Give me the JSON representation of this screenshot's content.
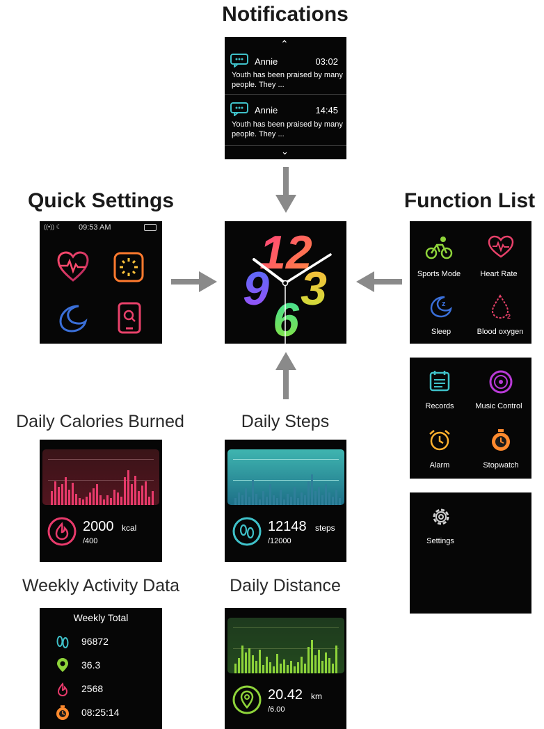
{
  "headings": {
    "notifications": "Notifications",
    "quick_settings": "Quick Settings",
    "function_list": "Function List"
  },
  "captions": {
    "calories": "Daily Calories Burned",
    "steps": "Daily Steps",
    "weekly": "Weekly Activity Data",
    "distance": "Daily Distance"
  },
  "notifications": {
    "items": [
      {
        "sender": "Annie",
        "time": "03:02",
        "text": "Youth has been praised by many people. They ..."
      },
      {
        "sender": "Annie",
        "time": "14:45",
        "text": "Youth has been praised by many people. They ..."
      }
    ]
  },
  "quick_settings": {
    "time": "09:53 AM"
  },
  "clock": {
    "numerals": [
      "12",
      "9",
      "3",
      "6"
    ]
  },
  "function_list": {
    "page1": [
      "Sports Mode",
      "Heart Rate",
      "Sleep",
      "Blood oxygen"
    ],
    "page2": [
      "Records",
      "Music Control",
      "Alarm",
      "Stopwatch"
    ],
    "page3": [
      "Settings"
    ]
  },
  "calories": {
    "value": "2000",
    "unit": "kcal",
    "goal": "/400",
    "color": "#e83a6b"
  },
  "steps": {
    "value": "12148",
    "unit": "steps",
    "goal": "/12000",
    "color": "#3fc1c9"
  },
  "distance": {
    "value": "20.42",
    "unit": "km",
    "goal": "/6.00",
    "color": "#8ed33a"
  },
  "weekly": {
    "title": "Weekly Total",
    "rows": [
      {
        "icon": "footprints-icon",
        "value": "96872"
      },
      {
        "icon": "location-pin-icon",
        "value": "36.3"
      },
      {
        "icon": "power-flame-icon",
        "value": "2568"
      },
      {
        "icon": "stopwatch-icon",
        "value": "08:25:14"
      }
    ]
  }
}
